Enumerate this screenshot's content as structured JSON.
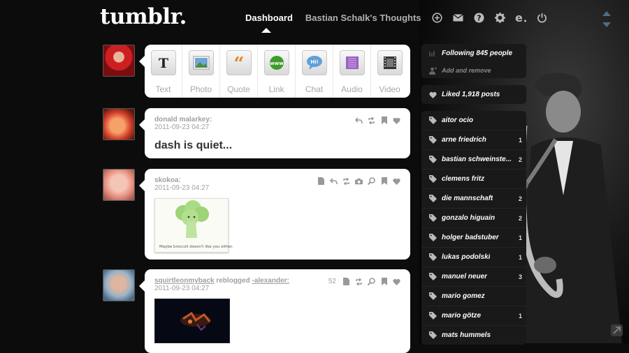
{
  "header": {
    "logo": "tumblr.",
    "nav": [
      "Dashboard",
      "Bastian Schalk's Thoughts"
    ],
    "icons": [
      "plus-icon",
      "mail-icon",
      "help-icon",
      "gear-icon",
      "e-icon",
      "power-icon"
    ]
  },
  "post_types": [
    {
      "label": "Text",
      "icon": "text-icon"
    },
    {
      "label": "Photo",
      "icon": "photo-icon"
    },
    {
      "label": "Quote",
      "icon": "quote-icon"
    },
    {
      "label": "Link",
      "icon": "link-icon"
    },
    {
      "label": "Chat",
      "icon": "chat-icon"
    },
    {
      "label": "Audio",
      "icon": "audio-icon"
    },
    {
      "label": "Video",
      "icon": "video-icon"
    }
  ],
  "posts": [
    {
      "author": "donald malarkey:",
      "date": "2011-09-23 04:27",
      "text": "dash is quiet..."
    },
    {
      "author": "skokoa:",
      "date": "2011-09-23 04:27",
      "caption": "Maybe broccoli doesn't like you either."
    },
    {
      "author": "squirtleonmyback",
      "reblogged": "reblogged",
      "source": "-alexander:",
      "date": "2011-09-23 04:27",
      "notes": "52"
    }
  ],
  "sidebar": {
    "following": "Following 845 people",
    "add_remove": "Add and remove",
    "liked": "Liked 1,918 posts",
    "tags": [
      {
        "name": "aitor ocio",
        "count": ""
      },
      {
        "name": "arne friedrich",
        "count": "1"
      },
      {
        "name": "bastian schweinste...",
        "count": "2"
      },
      {
        "name": "clemens fritz",
        "count": ""
      },
      {
        "name": "die mannschaft",
        "count": "2"
      },
      {
        "name": "gonzalo higuain",
        "count": "2"
      },
      {
        "name": "holger badstuber",
        "count": "1"
      },
      {
        "name": "lukas podolski",
        "count": "1"
      },
      {
        "name": "manuel neuer",
        "count": "3"
      },
      {
        "name": "mario gomez",
        "count": ""
      },
      {
        "name": "mario götze",
        "count": "1"
      },
      {
        "name": "mats hummels",
        "count": ""
      }
    ]
  },
  "colors": {
    "accent": "#4f6d8c",
    "background": "#0c0c0c"
  }
}
